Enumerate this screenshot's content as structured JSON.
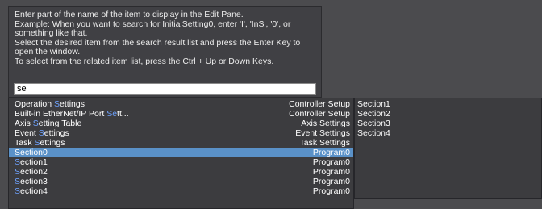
{
  "instructions": [
    "Enter part of the name of the item to display in the Edit Pane.",
    "Example: When you want to search for InitialSetting0, enter 'I', 'InS', '0', or",
    "something like that.",
    "Select the desired item from the search result list and press the Enter Key to",
    "open the window.",
    "To select from the related item list, press the Ctrl + Up or Down Keys."
  ],
  "search": {
    "value": "se"
  },
  "results": [
    {
      "pre": "Operation ",
      "hl": "S",
      "post": "ettings",
      "category": "Controller Setup",
      "selected": false
    },
    {
      "pre": "Built-in EtherNet/IP Port ",
      "hl": "Se",
      "post": "tt...",
      "category": "Controller Setup",
      "selected": false
    },
    {
      "pre": "Axis ",
      "hl": "S",
      "post": "etting Table",
      "category": "Axis Settings",
      "selected": false
    },
    {
      "pre": "Event ",
      "hl": "S",
      "post": "ettings",
      "category": "Event Settings",
      "selected": false
    },
    {
      "pre": "Task ",
      "hl": "S",
      "post": "ettings",
      "category": "Task Settings",
      "selected": false
    },
    {
      "pre": "",
      "hl": "Se",
      "post": "ction0",
      "category": "Program0",
      "selected": true
    },
    {
      "pre": "",
      "hl": "S",
      "post": "ection1",
      "category": "Program0",
      "selected": false
    },
    {
      "pre": "",
      "hl": "S",
      "post": "ection2",
      "category": "Program0",
      "selected": false
    },
    {
      "pre": "",
      "hl": "S",
      "post": "ection3",
      "category": "Program0",
      "selected": false
    },
    {
      "pre": "",
      "hl": "S",
      "post": "ection4",
      "category": "Program0",
      "selected": false
    }
  ],
  "related": [
    "Section1",
    "Section2",
    "Section3",
    "Section4"
  ],
  "colors": {
    "background": "#4b4b4e",
    "panel": "#3c3c3f",
    "selection": "#5a91c8",
    "match_highlight": "#6fa3ff"
  }
}
